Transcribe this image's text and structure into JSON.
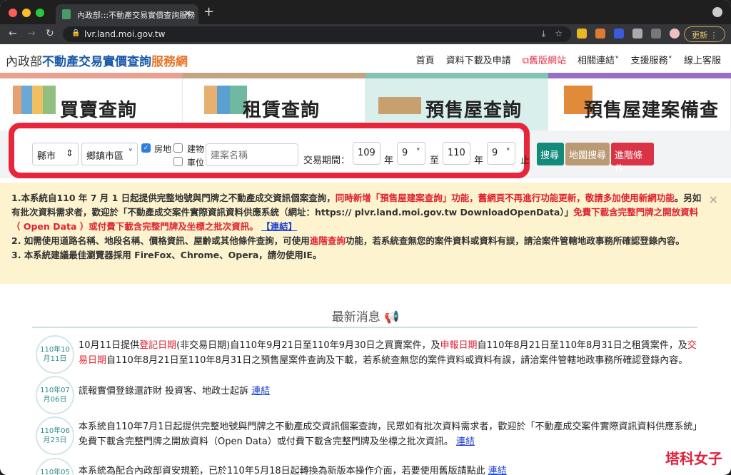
{
  "browser": {
    "tab_title": "內政部:::不動產交易實價查詢服務",
    "url": "lvr.land.moi.gov.tw",
    "update_label": "更新"
  },
  "header": {
    "logo_moi": "內政部",
    "logo_main": "不動產交易實價查詢",
    "logo_suffix": "服務網",
    "menu": [
      "首頁",
      "資料下載及申請",
      "舊版網站",
      "相關連結",
      "支援服務",
      "線上客服"
    ]
  },
  "stripe_colors": [
    "#e9a08f",
    "#c3a47f",
    "#84c2b4",
    "#9a6ec4"
  ],
  "categories": [
    {
      "label": "買賣查詢"
    },
    {
      "label": "租賃查詢"
    },
    {
      "label": "預售屋查詢",
      "active": true
    },
    {
      "label": "預售屋建案備查"
    }
  ],
  "search": {
    "city": "縣市",
    "district": "鄉鎮市區",
    "chk_land": "房地",
    "chk_building": "建物",
    "chk_parking": "車位",
    "project_placeholder": "建案名稱",
    "period_label": "交易期間：",
    "from_year": "109",
    "year1": "年",
    "from_month": "9",
    "to": "至",
    "to_year": "110",
    "year2": "年",
    "to_month": "9",
    "end": "止",
    "btn_search": "搜尋",
    "btn_map": "地圖搜尋",
    "btn_adv": "進階條件"
  },
  "alert": {
    "p1a": "1.本系統自110 年 7 月 1 日起提供完整地號與門牌之不動產成交資訊個案查詢，",
    "p1b": "同時新增「預售屋建案查詢」功能，舊網頁不再進行功能更新，敬請多加使用新網功能",
    "p1c": "。另如有批次資料需求者，歡迎於「不動產成交案件實際資訊資料供應系統（網址：https:// plvr.land.moi.gov.tw DownloadOpenData）」",
    "p1d": "免費下載含完整門牌之開放資料（ Open Data ）或付費下載含完整門牌及坐標之批次資訊。",
    "p1link": "【連結】",
    "p2a": "2. 如需使用道路名稱、地段名稱、價格資訊、屋齡或其他條件查詢，可使用",
    "p2b": "進階查詢",
    "p2c": "功能，若系統查無您的案件資料或資料有誤，請洽案件管轄地政事務所確認登錄內容。",
    "p3": "3. 本系統建議最佳瀏覽器採用 FireFox、Chrome、Opera，請勿使用IE。",
    "close": "×"
  },
  "news": {
    "title": "最新消息",
    "items": [
      {
        "date1": "110年10",
        "date2": "月11日",
        "t1": "10月11日提供",
        "r1": "登記日期",
        "t2": "(非交易日期)自110年9月21日至110年9月30日之買賣案件，及",
        "r2": "申報日期",
        "t3": "自110年8月21日至110年8月31日之租賃案件，及",
        "r3": "交易日期",
        "t4": "自110年8月21日至110年8月31日之預售屋案件查詢及下載，若系統查無您的案件資料或資料有誤，請洽案件管轄地政事務所確認登錄內容。"
      },
      {
        "date1": "110年07",
        "date2": "月06日",
        "t1": "謊報實價登錄還詐財 投資客、地政士起訴 ",
        "link": "連結"
      },
      {
        "date1": "110年06",
        "date2": "月23日",
        "t1": "本系統自110年7月1日起提供完整地號與門牌之不動產成交資訊個案查詢，民眾如有批次資料需求者，歡迎於「不動產成交案件實際資訊資料供應系統」免費下載含完整門牌之開放資料（Open Data）或付費下載含完整門牌及坐標之批次資訊。 ",
        "link": "連結"
      },
      {
        "date1": "110年05",
        "t1": "本系統為配合內政部資安規範，已於110年5月18日起轉換為新版本操作介面，若要使用舊版請點此 ",
        "link": "連結"
      }
    ]
  },
  "watermark": "塔科女子"
}
